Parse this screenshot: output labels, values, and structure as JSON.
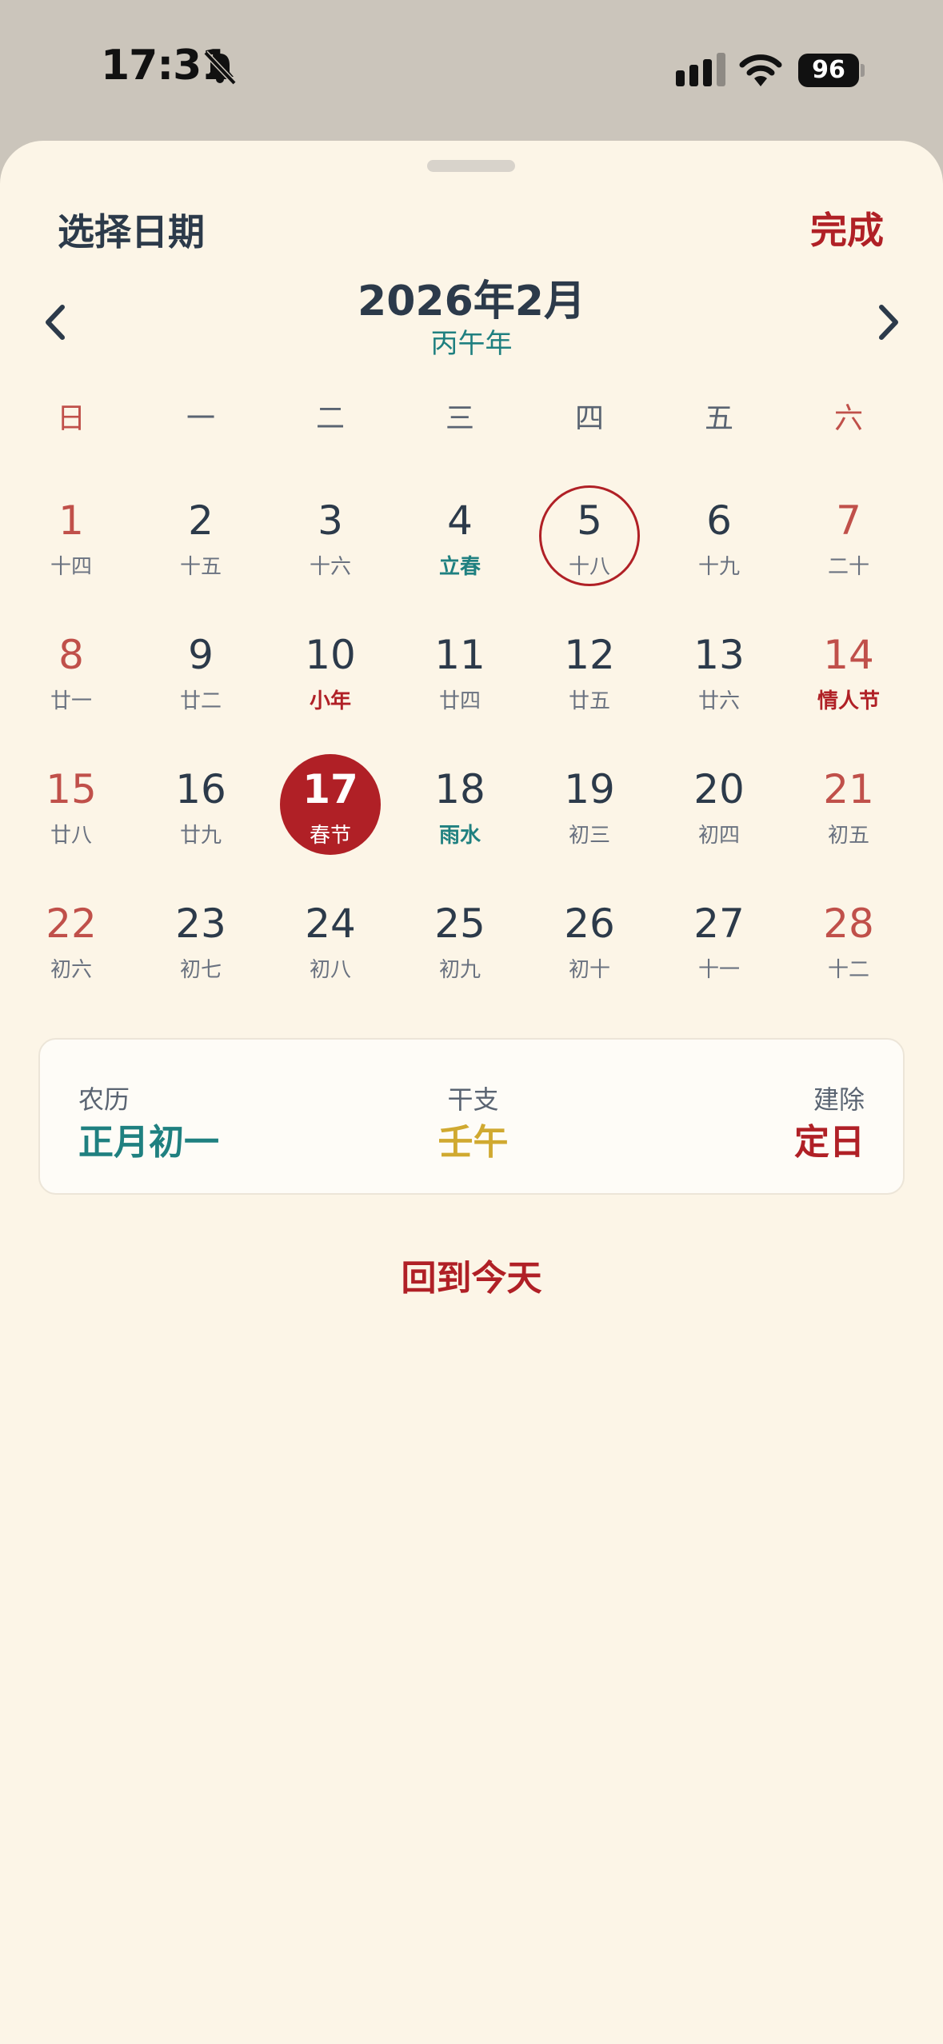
{
  "status": {
    "time": "17:31",
    "battery": "96"
  },
  "sheet": {
    "title": "选择日期",
    "done_label": "完成"
  },
  "calendar": {
    "month_title": "2026年2月",
    "ganzhi_year": "丙午年",
    "weekdays": [
      "日",
      "一",
      "二",
      "三",
      "四",
      "五",
      "六"
    ],
    "days": [
      {
        "n": "1",
        "l": "十四"
      },
      {
        "n": "2",
        "l": "十五"
      },
      {
        "n": "3",
        "l": "十六"
      },
      {
        "n": "4",
        "l": "立春",
        "k": "term"
      },
      {
        "n": "5",
        "l": "十八",
        "today": true
      },
      {
        "n": "6",
        "l": "十九"
      },
      {
        "n": "7",
        "l": "二十"
      },
      {
        "n": "8",
        "l": "廿一"
      },
      {
        "n": "9",
        "l": "廿二"
      },
      {
        "n": "10",
        "l": "小年",
        "k": "fest"
      },
      {
        "n": "11",
        "l": "廿四"
      },
      {
        "n": "12",
        "l": "廿五"
      },
      {
        "n": "13",
        "l": "廿六"
      },
      {
        "n": "14",
        "l": "情人节",
        "k": "fest"
      },
      {
        "n": "15",
        "l": "廿八"
      },
      {
        "n": "16",
        "l": "廿九"
      },
      {
        "n": "17",
        "l": "春节",
        "selected": true
      },
      {
        "n": "18",
        "l": "雨水",
        "k": "term"
      },
      {
        "n": "19",
        "l": "初三"
      },
      {
        "n": "20",
        "l": "初四"
      },
      {
        "n": "21",
        "l": "初五"
      },
      {
        "n": "22",
        "l": "初六"
      },
      {
        "n": "23",
        "l": "初七"
      },
      {
        "n": "24",
        "l": "初八"
      },
      {
        "n": "25",
        "l": "初九"
      },
      {
        "n": "26",
        "l": "初十"
      },
      {
        "n": "27",
        "l": "十一"
      },
      {
        "n": "28",
        "l": "十二"
      }
    ]
  },
  "info": {
    "lunar_label": "农历",
    "lunar_value": "正月初一",
    "ganzhi_label": "干支",
    "ganzhi_value": "壬午",
    "jianchu_label": "建除",
    "jianchu_value": "定日"
  },
  "back_today_label": "回到今天",
  "colors": {
    "accent_red": "#b02026",
    "teal": "#1f8080",
    "gold": "#d0a930",
    "background": "#fcf5e7"
  }
}
